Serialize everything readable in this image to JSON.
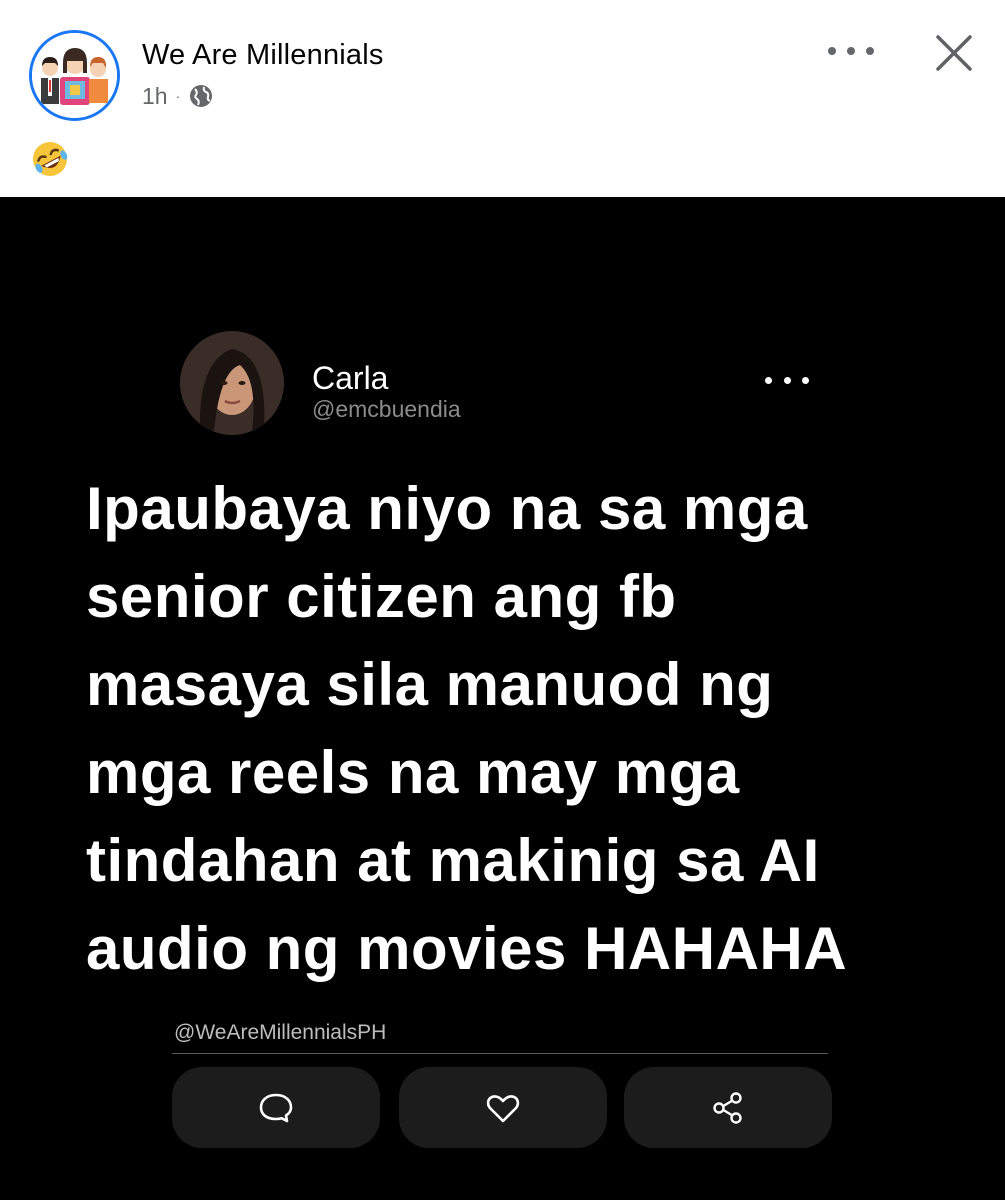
{
  "post": {
    "page_name": "We Are Millennials",
    "time": "1h",
    "separator": "·",
    "audience_icon": "globe-icon",
    "caption_emoji": "rolling-on-floor-laughing-emoji",
    "more_icon": "more-horizontal-icon",
    "close_icon": "close-icon"
  },
  "image": {
    "background": "#000000",
    "tweet": {
      "display_name": "Carla",
      "handle": "@emcbuendia",
      "lines": [
        "Ipaubaya niyo na sa mga",
        "senior citizen ang fb",
        "masaya sila manuod ng",
        "mga reels na may mga",
        "tindahan at makinig sa AI",
        "audio ng movies HAHAHA"
      ]
    },
    "watermark": "@WeAreMillennialsPH",
    "actions": [
      {
        "icon": "comment-icon"
      },
      {
        "icon": "heart-icon"
      },
      {
        "icon": "share-icon"
      }
    ]
  },
  "colors": {
    "brand_blue": "#1877f2",
    "meta_gray": "#65676b",
    "card_button": "#1c1c1c"
  }
}
